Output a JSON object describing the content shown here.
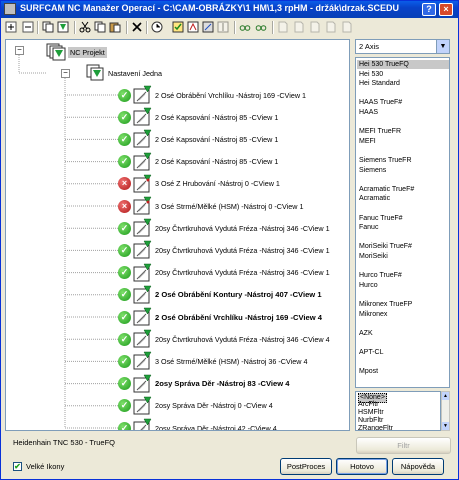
{
  "window": {
    "title": "SURFCAM NC Manažer Operací - C:\\CAM-OBRÁZKY\\1 HM\\1,3 rpHM - držák\\drzak.SCEDU",
    "help_label": "?",
    "close_label": "×"
  },
  "toolbar": {
    "buttons": [
      {
        "name": "expand-all",
        "icon": "plus-box-icon"
      },
      {
        "name": "collapse-all",
        "icon": "minus-box-icon"
      },
      {
        "name": "cut-group",
        "icon": "copy-icon"
      },
      {
        "name": "new-setup",
        "icon": "setup-icon"
      },
      {
        "name": "cut",
        "icon": "scissors-icon"
      },
      {
        "name": "copy",
        "icon": "copy-icon"
      },
      {
        "name": "paste",
        "icon": "paste-icon"
      },
      {
        "name": "delete",
        "icon": "delete-x-icon"
      },
      {
        "name": "timer",
        "icon": "clock-icon"
      },
      {
        "name": "verify",
        "icon": "checkmark-icon"
      },
      {
        "name": "simulate",
        "icon": "sim-icon"
      },
      {
        "name": "gouge-check",
        "icon": "gouge-icon"
      },
      {
        "name": "tool-info",
        "icon": "tool-icon"
      },
      {
        "name": "view",
        "icon": "glasses-icon"
      },
      {
        "name": "view2",
        "icon": "glasses-icon"
      },
      {
        "name": "page1",
        "icon": "page-icon"
      },
      {
        "name": "page2",
        "icon": "page-icon"
      },
      {
        "name": "page3",
        "icon": "page-icon"
      },
      {
        "name": "page4",
        "icon": "page-icon"
      },
      {
        "name": "page5",
        "icon": "page-icon"
      }
    ]
  },
  "tree": {
    "root": "NC Projekt",
    "setup": "Nastavení Jedna",
    "operations": [
      {
        "status": "ok",
        "text": "2 Osé Obrábění Vrchlíku -Nástroj 169 -CView 1",
        "bold": false
      },
      {
        "status": "ok",
        "text": "2 Osé Kapsování  -Nástroj 85 -CView 1",
        "bold": false
      },
      {
        "status": "ok",
        "text": "2 Osé Kapsování  -Nástroj 85 -CView 1",
        "bold": false
      },
      {
        "status": "ok",
        "text": "2 Osé Kapsování  -Nástroj 85 -CView 1",
        "bold": false
      },
      {
        "status": "error",
        "text": "3 Osé Z Hrubování  -Nástroj 0 -CView 1",
        "bold": false
      },
      {
        "status": "error",
        "text": "3 Osé Strmé/Mělké (HSM)  -Nástroj 0 -CView 1",
        "bold": false
      },
      {
        "status": "ok",
        "text": "20sy Čtvrtkruhová Vydutá Fréza  -Nástroj 346 -CView 1",
        "bold": false
      },
      {
        "status": "ok",
        "text": "20sy Čtvrtkruhová Vydutá Fréza  -Nástroj 346 -CView 1",
        "bold": false
      },
      {
        "status": "ok",
        "text": "20sy Čtvrtkruhová Vydutá Fréza  -Nástroj 346 -CView 1",
        "bold": false
      },
      {
        "status": "ok",
        "text": "2 Osé Obrábění Kontury  -Nástroj 407 -CView 1",
        "bold": true
      },
      {
        "status": "ok",
        "text": "2 Osé Obrábění Vrchlíku  -Nástroj 169 -CView 4",
        "bold": true
      },
      {
        "status": "ok",
        "text": "20sy Čtvrtkruhová Vydutá Fréza  -Nástroj 346 -CView 4",
        "bold": false
      },
      {
        "status": "ok",
        "text": "3 Osé Strmé/Mělké (HSM)  -Nástroj 36 -CView 4",
        "bold": false
      },
      {
        "status": "ok",
        "text": "2osy Správa Děr  -Nástroj 83 -CView 4",
        "bold": true
      },
      {
        "status": "ok",
        "text": "2osy Správa Děr  -Nástroj 0 -CView 4",
        "bold": false
      },
      {
        "status": "ok",
        "text": "2osy Správa Děr  -Nástroj 42 -CView 4",
        "bold": false
      }
    ]
  },
  "machine_select": {
    "value": "2 Axis",
    "arrow": "▼"
  },
  "post_list": [
    "Hei 530 TrueFQ",
    "Hei 530",
    "Hei Standard",
    "",
    "HAAS TrueF#",
    "HAAS",
    "",
    "MEFI TrueFR",
    "MEFI",
    "",
    "Siemens TrueFR",
    "Siemens",
    "",
    "Acramatic TrueF#",
    "Acramatic",
    "",
    "Fanuc TrueF#",
    "Fanuc",
    "",
    "MoriSeiki TrueF#",
    "MoriSeiki",
    "",
    "Hurco TrueF#",
    "Hurco",
    "",
    "Mikronex TrueFP",
    "Mikronex",
    "",
    "AZK",
    "",
    "APT-CL",
    "",
    "Mpost"
  ],
  "filter_list": [
    "<None>",
    "ArcFltr",
    "HSMFltr",
    "NurbFltr",
    "ZRangeFltr"
  ],
  "bottom": {
    "post_name": "Heidenhain TNC 530 - TrueFQ",
    "filtr_label": "Filtr",
    "large_icons_label": "Velké Ikony",
    "large_icons_checked": "✔",
    "postproces_label": "PostProces",
    "hotovo_label": "Hotovo",
    "napoveda_label": "Nápověda"
  }
}
